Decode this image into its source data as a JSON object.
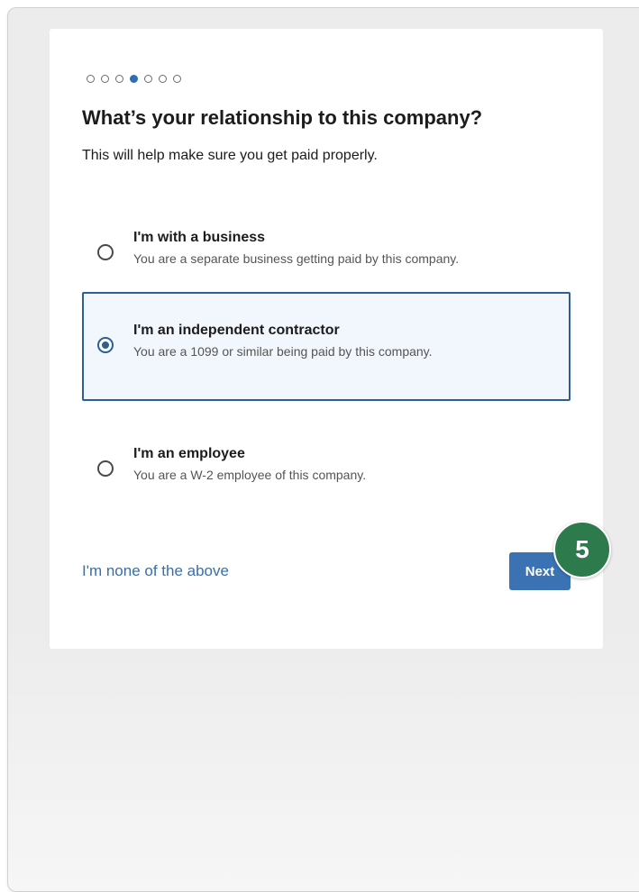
{
  "progress": {
    "total_steps": 7,
    "current_step": 4
  },
  "header": {
    "title": "What’s your relationship to this company?",
    "subtitle": "This will help make sure you get paid properly."
  },
  "options": [
    {
      "label": "I'm with a business",
      "description": "You are a separate business getting paid by this company.",
      "selected": false
    },
    {
      "label": "I'm an independent contractor",
      "description": "You are a 1099 or similar being paid by this company.",
      "selected": true
    },
    {
      "label": "I'm an employee",
      "description": "You are a W-2 employee of this company.",
      "selected": false
    }
  ],
  "footer": {
    "none_link": "I'm none of the above",
    "next_label": "Next"
  },
  "annotation": {
    "step_badge": "5"
  },
  "colors": {
    "accent": "#3a72b4",
    "selected_border": "#2d5f96",
    "selected_bg": "#f1f7fd",
    "link": "#3b6ea8",
    "badge": "#2d7a4d"
  }
}
